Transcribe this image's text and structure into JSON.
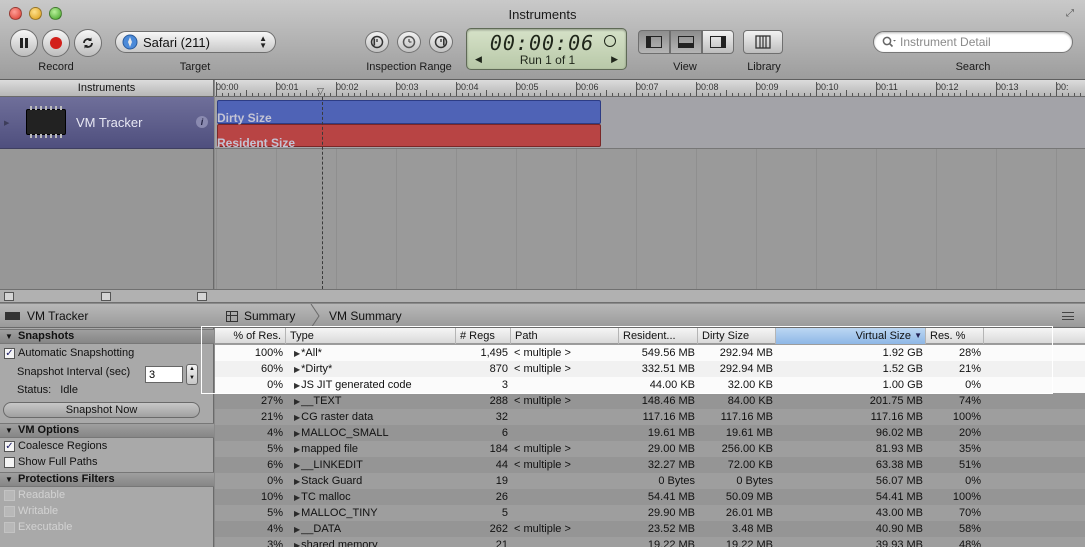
{
  "window": {
    "title": "Instruments"
  },
  "toolbar": {
    "record_label": "Record",
    "target_label": "Target",
    "target_value": "Safari (211)",
    "inspection_range_label": "Inspection Range",
    "timer": "00:00:06",
    "run": "Run 1 of 1",
    "view_label": "View",
    "library_label": "Library",
    "search_label": "Search",
    "search_placeholder": "Instrument Detail"
  },
  "instruments": {
    "header": "Instruments",
    "items": [
      {
        "name": "VM Tracker"
      }
    ]
  },
  "timeline": {
    "ticks": [
      "00:00",
      "00:01",
      "00:02",
      "00:03",
      "00:04",
      "00:05",
      "00:06",
      "00:07",
      "00:08",
      "00:09",
      "00:10",
      "00:11",
      "00:12",
      "00:13",
      "00:"
    ],
    "bands": {
      "dirty": "Dirty Size",
      "resident": "Resident Size"
    }
  },
  "detail": {
    "instrument": "VM Tracker",
    "breadcrumb": [
      "Summary",
      "VM Summary"
    ]
  },
  "options": {
    "snapshots": {
      "title": "Snapshots",
      "automatic": "Automatic Snapshotting",
      "interval_label": "Snapshot Interval (sec)",
      "interval_value": "3",
      "status_label": "Status:",
      "status_value": "Idle",
      "snapshot_now": "Snapshot Now"
    },
    "vm_options": {
      "title": "VM Options",
      "coalesce": "Coalesce Regions",
      "full_paths": "Show Full Paths"
    },
    "protections": {
      "title": "Protections Filters",
      "readable": "Readable",
      "writable": "Writable",
      "executable": "Executable"
    }
  },
  "table": {
    "columns": [
      "% of Res.",
      "Type",
      "# Regs",
      "Path",
      "Resident...",
      "Dirty Size",
      "Virtual Size",
      "Res. %"
    ],
    "rows": [
      [
        "100%",
        "*All*",
        "1,495",
        "< multiple >",
        "549.56 MB",
        "292.94 MB",
        "1.92 GB",
        "28%"
      ],
      [
        "60%",
        "*Dirty*",
        "870",
        "< multiple >",
        "332.51 MB",
        "292.94 MB",
        "1.52 GB",
        "21%"
      ],
      [
        "0%",
        "JS JIT generated code",
        "3",
        "",
        "44.00 KB",
        "32.00 KB",
        "1.00 GB",
        "0%"
      ],
      [
        "27%",
        "__TEXT",
        "288",
        "< multiple >",
        "148.46 MB",
        "84.00 KB",
        "201.75 MB",
        "74%"
      ],
      [
        "21%",
        "CG raster data",
        "32",
        "",
        "117.16 MB",
        "117.16 MB",
        "117.16 MB",
        "100%"
      ],
      [
        "4%",
        "MALLOC_SMALL",
        "6",
        "",
        "19.61 MB",
        "19.61 MB",
        "96.02 MB",
        "20%"
      ],
      [
        "5%",
        "mapped file",
        "184",
        "< multiple >",
        "29.00 MB",
        "256.00 KB",
        "81.93 MB",
        "35%"
      ],
      [
        "6%",
        "__LINKEDIT",
        "44",
        "< multiple >",
        "32.27 MB",
        "72.00 KB",
        "63.38 MB",
        "51%"
      ],
      [
        "0%",
        "Stack Guard",
        "19",
        "",
        "0 Bytes",
        "0 Bytes",
        "56.07 MB",
        "0%"
      ],
      [
        "10%",
        "TC malloc",
        "26",
        "",
        "54.41 MB",
        "50.09 MB",
        "54.41 MB",
        "100%"
      ],
      [
        "5%",
        "MALLOC_TINY",
        "5",
        "",
        "29.90 MB",
        "26.01 MB",
        "43.00 MB",
        "70%"
      ],
      [
        "4%",
        "__DATA",
        "262",
        "< multiple >",
        "23.52 MB",
        "3.48 MB",
        "40.90 MB",
        "58%"
      ],
      [
        "3%",
        "shared memory",
        "21",
        "",
        "19.22 MB",
        "19.22 MB",
        "39.93 MB",
        "48%"
      ]
    ]
  }
}
